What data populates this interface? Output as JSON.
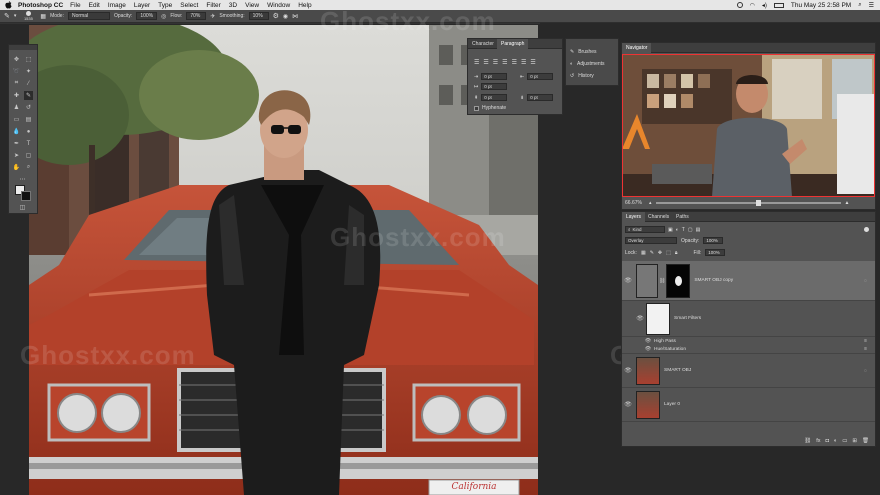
{
  "menubar": {
    "app": "Photoshop CC",
    "items": [
      "File",
      "Edit",
      "Image",
      "Layer",
      "Type",
      "Select",
      "Filter",
      "3D",
      "View",
      "Window",
      "Help"
    ],
    "datetime": "Thu May 25  2:58 PM"
  },
  "options": {
    "mode_label": "Mode:",
    "mode_value": "Normal",
    "opacity_label": "Opacity:",
    "opacity_value": "100%",
    "flow_label": "Flow:",
    "flow_value": "70%",
    "smoothing_label": "Smoothing:",
    "smoothing_value": "10%",
    "brush_size": "1535"
  },
  "character_panel": {
    "tabs": [
      "Character",
      "Paragraph"
    ],
    "fields": [
      "0 pt",
      "0 pt",
      "0 pt",
      "0 pt",
      "0 pt"
    ],
    "hyphenate": "Hyphenate"
  },
  "side_panel": {
    "items": [
      "Brushes",
      "Adjustments",
      "History"
    ]
  },
  "navigator": {
    "title": "Navigator",
    "zoom": "66.67%"
  },
  "layers_panel": {
    "tabs": [
      "Layers",
      "Channels",
      "Paths"
    ],
    "kind": "Kind",
    "blend_mode": "Overlay",
    "opacity_label": "Opacity:",
    "opacity_value": "100%",
    "lock_label": "Lock:",
    "fill_label": "Fill:",
    "fill_value": "100%",
    "layers": [
      {
        "name": "SMART OBJ copy"
      },
      {
        "name": "Smart Filters"
      },
      {
        "name": "High Pass"
      },
      {
        "name": "Hue/Saturation"
      },
      {
        "name": "SMART OBJ"
      },
      {
        "name": "Layer 0"
      }
    ]
  },
  "watermark": "Ghostxx.com",
  "license_plate": "California",
  "colors": {
    "accent": "#3c83d6",
    "car": "#b8442c"
  }
}
